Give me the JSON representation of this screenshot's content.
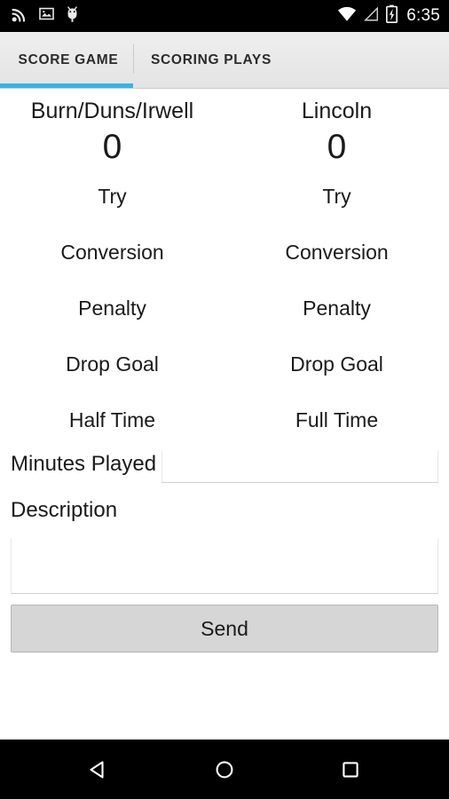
{
  "status_bar": {
    "icons_left": [
      "cast-icon",
      "image-icon",
      "android-debug-icon"
    ],
    "icons_right": [
      "wifi-icon",
      "cellular-signal-icon",
      "battery-charging-icon"
    ],
    "time": "6:35",
    "background_color": "#000000"
  },
  "tabs": {
    "accent_color": "#33b5e5",
    "items": [
      {
        "label": "SCORE GAME",
        "active": true
      },
      {
        "label": "SCORING PLAYS",
        "active": false
      }
    ]
  },
  "score": {
    "columns": [
      {
        "team_name": "Burn/Duns/Irwell",
        "score": "0",
        "actions": [
          "Try",
          "Conversion",
          "Penalty",
          "Drop Goal",
          "Half Time"
        ]
      },
      {
        "team_name": "Lincoln",
        "score": "0",
        "actions": [
          "Try",
          "Conversion",
          "Penalty",
          "Drop Goal",
          "Full Time"
        ]
      }
    ]
  },
  "form": {
    "minutes_label": "Minutes Played",
    "minutes_value": "",
    "minutes_placeholder": "",
    "description_label": "Description",
    "description_value": "",
    "description_placeholder": "",
    "send_label": "Send"
  },
  "nav_bar": {
    "buttons": [
      "back-icon",
      "home-icon",
      "recents-icon"
    ],
    "background_color": "#000000"
  }
}
